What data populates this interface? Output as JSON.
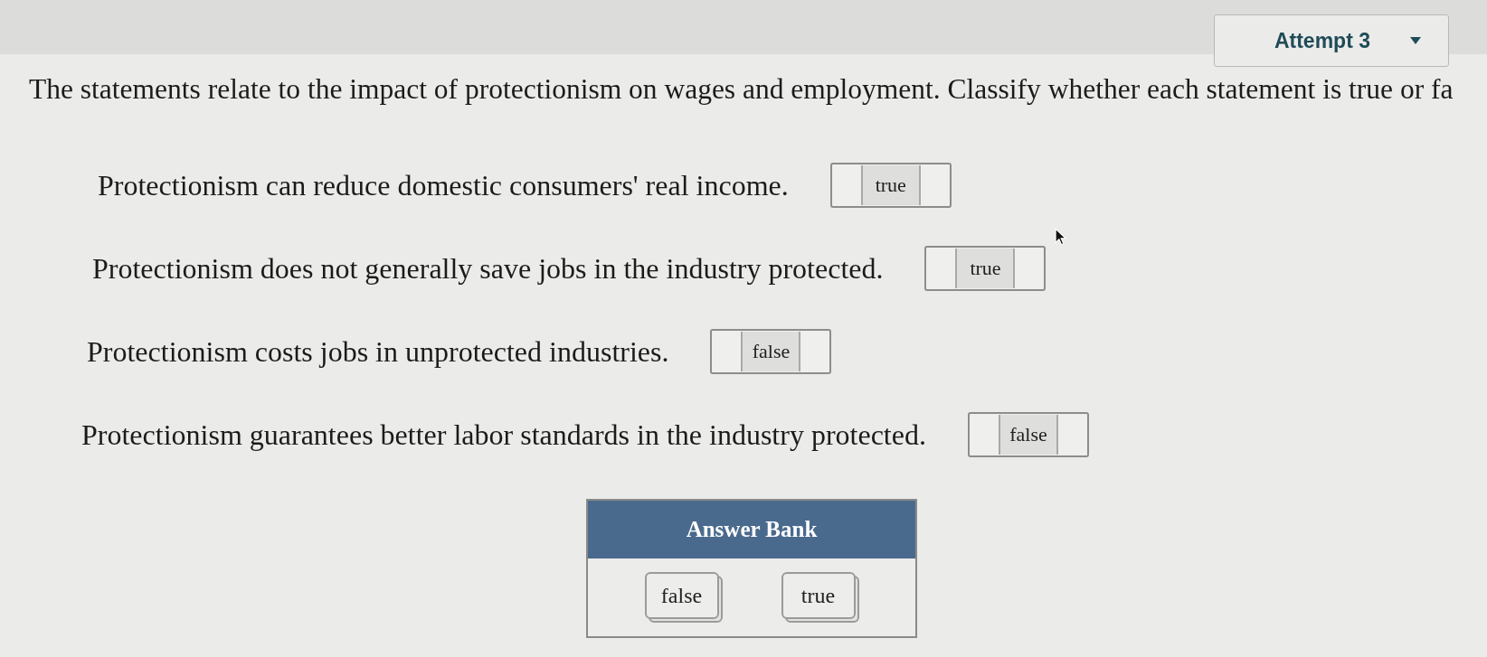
{
  "attempt_selector": {
    "label": "Attempt 3"
  },
  "question": {
    "prompt": "The statements relate to the impact of protectionism on wages and employment. Classify whether each statement is true or fa"
  },
  "statements": [
    {
      "text": "Protectionism can reduce domestic consumers' real income.",
      "answer": "true"
    },
    {
      "text": "Protectionism does not generally save jobs in the industry protected.",
      "answer": "true"
    },
    {
      "text": "Protectionism costs jobs in unprotected industries.",
      "answer": "false"
    },
    {
      "text": "Protectionism guarantees better labor standards in the industry protected.",
      "answer": "false"
    }
  ],
  "answer_bank": {
    "title": "Answer Bank",
    "options": [
      "false",
      "true"
    ]
  }
}
